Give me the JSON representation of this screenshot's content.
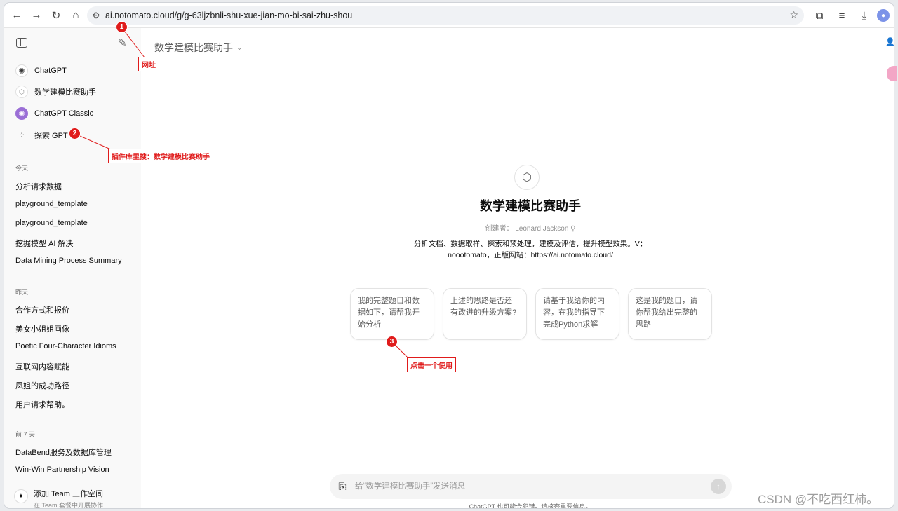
{
  "browser": {
    "url": "ai.notomato.cloud/g/g-63ljzbnli-shu-xue-jian-mo-bi-sai-zhu-shou"
  },
  "sidebar": {
    "gpts": [
      {
        "label": "ChatGPT",
        "icon": "chatgpt-logo-icon"
      },
      {
        "label": "数学建模比赛助手",
        "icon": "cube-icon"
      },
      {
        "label": "ChatGPT Classic",
        "icon": "classic-logo-icon"
      },
      {
        "label": "探索 GPT",
        "icon": "grid-icon"
      }
    ],
    "sections": [
      {
        "title": "今天",
        "items": [
          "分析请求数据",
          "playground_template",
          "playground_template",
          "挖掘模型 AI 解决",
          "Data Mining Process Summary"
        ]
      },
      {
        "title": "昨天",
        "items": [
          "合作方式和报价",
          "美女小姐姐画像",
          "Poetic Four-Character Idioms",
          "互联网内容赋能",
          "凤姐的成功路径",
          "用户请求帮助。"
        ]
      },
      {
        "title": "前 7 天",
        "items": [
          "DataBend服务及数据库管理",
          "Win-Win Partnership Vision"
        ]
      }
    ],
    "team": {
      "title": "添加 Team 工作空间",
      "subtitle": "在 Team 套餐中开展协作"
    }
  },
  "main": {
    "model_title": "数学建模比赛助手",
    "gpt_name": "数学建模比赛助手",
    "author": "创建者：  Leonard Jackson",
    "description_line1": "分析文档、数据取样、探索和预处理，建模及评估，提升模型效果。V：",
    "description_line2": "noootomato，正版网站：https://ai.notomato.cloud/",
    "cards": [
      "我的完整题目和数据如下，请帮我开始分析",
      "上述的思路是否还有改进的升级方案?",
      "请基于我给你的内容，在我的指导下完成Python求解",
      "这是我的题目，请你帮我给出完整的思路"
    ],
    "composer_placeholder": "给“数学建模比赛助手”发送消息",
    "footer_note": "ChatGPT 也可能会犯错。请核查重要信息。"
  },
  "annotations": [
    {
      "number": "1",
      "label": "网址"
    },
    {
      "number": "2",
      "label": "插件库里搜：数学建模比赛助手"
    },
    {
      "number": "3",
      "label": "点击一个使用"
    }
  ],
  "watermark": "CSDN @不吃西红柿。",
  "colors": {
    "annotation": "#e01b1b",
    "classic_icon": "#9b6fd6"
  }
}
